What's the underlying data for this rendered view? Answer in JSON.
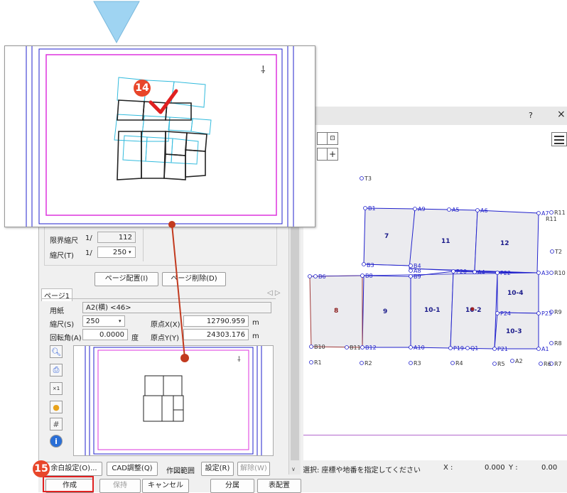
{
  "colors": {
    "accent_red": "#e8462a",
    "blue_frame": "#2222cc",
    "magenta_frame": "#dd33dd",
    "parcel_fill": "#ebebef"
  },
  "cad": {
    "title_help": "?",
    "title_close": "×",
    "menu_icon": "hamburger-icon",
    "status": {
      "hint": "選択: 座標や地番を指定してください",
      "x_label": "X :",
      "x_value": "0.000",
      "y_label": "Y :",
      "y_value": "0.00"
    },
    "parcels": [
      "7",
      "11",
      "12",
      "10-4",
      "8",
      "9",
      "10-1",
      "10-2",
      "10-3"
    ],
    "points": {
      "T3": "T3",
      "B1": "B1",
      "A9": "A9",
      "A5": "A5",
      "A6": "A6",
      "A7": "A7",
      "R11": "R11",
      "R11b": "R11",
      "T2": "T2",
      "B3": "B3",
      "B4": "B4",
      "A8": "A8",
      "B6": "B6",
      "B9": "B9",
      "B8": "B8",
      "P20": "P20",
      "A4": "A4",
      "P22": "P22",
      "A3": "A3",
      "R10": "R10",
      "P24": "P24",
      "P23": "P23",
      "R9": "R9",
      "B10": "B10",
      "B11": "B11",
      "B12": "B12",
      "A10": "A10",
      "P19": "P19",
      "Q1": "Q1",
      "P21": "P21",
      "A1": "A1",
      "R8": "R8",
      "A2": "A2",
      "R1": "R1",
      "R2": "R2",
      "R3": "R3",
      "R4": "R4",
      "R5": "R5",
      "R6": "R6",
      "R7": "R7"
    }
  },
  "dialog": {
    "limit_scale_label": "限界縮尺",
    "limit_scale_prefix": "1/",
    "limit_scale_value": "112",
    "scale_t_label": "縮尺(T)",
    "scale_t_prefix": "1/",
    "scale_t_value": "250",
    "page_place_button": "ページ配置(I)",
    "page_delete_button": "ページ削除(D)",
    "tab_page1": "ページ1",
    "tab_nav": "◁ ▷",
    "paper_label": "用紙",
    "paper_value": "A2(横) <46>",
    "scale_s_label": "縮尺(S)",
    "scale_s_value": "250",
    "origin_x_label": "原点X(X)",
    "origin_x_value": "12790.959",
    "origin_x_unit": "m",
    "rotation_label": "回転角(A)",
    "rotation_value": "0.0000",
    "rotation_unit": "度",
    "origin_y_label": "原点Y(Y)",
    "origin_y_value": "24303.176",
    "origin_y_unit": "m",
    "margin_button": "余白設定(O)...",
    "cad_adjust_button": "CAD調整(Q)",
    "range_label": "作図範囲",
    "set_button": "設定(R)",
    "clear_button": "解除(W)",
    "create_button": "作成",
    "hold_button": "保持",
    "cancel_button": "キャンセル",
    "split_button": "分属",
    "table_button": "表配置"
  },
  "steps": {
    "step14": "14",
    "step15": "15"
  },
  "tool_icons": [
    "zoom-icon",
    "print-preview-icon",
    "scale-1x-icon",
    "lightbulb-icon",
    "grid-icon",
    "info-icon"
  ]
}
